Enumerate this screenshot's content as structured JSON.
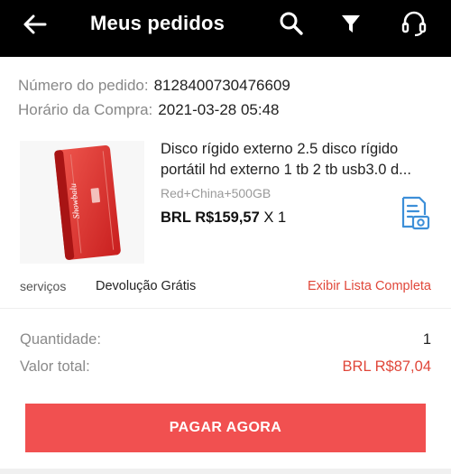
{
  "header": {
    "title": "Meus pedidos",
    "icons": [
      "back-arrow-icon",
      "search-icon",
      "filter-icon",
      "headset-icon"
    ],
    "background": "#000000"
  },
  "order": {
    "number_label": "Número do pedido:",
    "number_value": "8128400730476609",
    "time_label": "Horário da Compra:",
    "time_value": "2021-03-28 05:48"
  },
  "product": {
    "image_brand_text": "Showbalu",
    "title": "Disco rígido externo 2.5 disco rígido portátil hd externo 1 tb 2 tb usb3.0 d...",
    "variant": "Red+China+500GB",
    "price": "BRL R$159,57",
    "quantity": "X 1"
  },
  "services": {
    "label": "serviços",
    "value": "Devolução Grátis",
    "link": "Exibir Lista Completa"
  },
  "summary": {
    "quantity_label": "Quantidade:",
    "quantity_value": "1",
    "total_label": "Valor total:",
    "total_value": "BRL R$87,04"
  },
  "actions": {
    "pay_label": "PAGAR AGORA"
  },
  "colors": {
    "accent_red": "#f15050",
    "link_red": "#e0473a",
    "icon_blue": "#3d8fd8"
  }
}
